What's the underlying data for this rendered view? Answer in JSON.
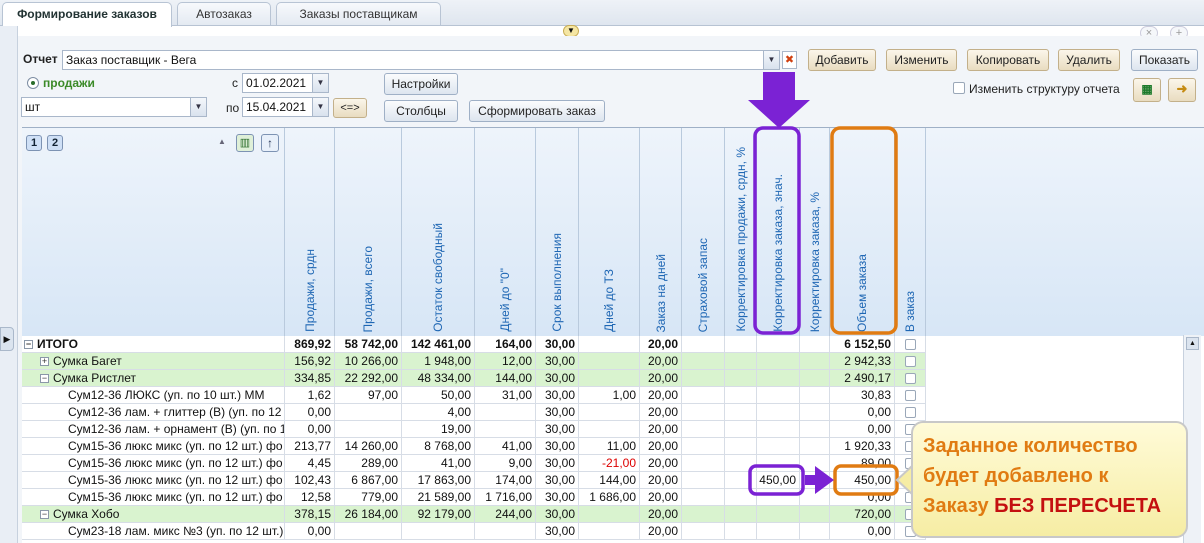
{
  "tabs": [
    "Формирование заказов",
    "Автозаказ",
    "Заказы поставщикам"
  ],
  "toolbar": {
    "report_label": "Отчет",
    "report_value": "Заказ поставщик - Вега",
    "buttons": [
      "Добавить",
      "Изменить",
      "Копировать",
      "Удалить",
      "Показать"
    ],
    "radio_label": "продажи",
    "unit_value": "шт",
    "from_label": "с",
    "from_date": "01.02.2021",
    "to_label": "по",
    "to_date": "15.04.2021",
    "swap_label": "<=>",
    "settings_label": "Настройки",
    "columns_label": "Столбцы",
    "make_order_label": "Сформировать заказ",
    "change_structure_label": "Изменить структуру отчета",
    "level1": "1",
    "level2": "2"
  },
  "columns": [
    "Продажи, срдн",
    "Продажи, всего",
    "Остаток свободный",
    "Дней до \"0\"",
    "Срок выполнения",
    "Дней до ТЗ",
    "Заказ на дней",
    "Страховой запас",
    "Корректировка продажи, срдн, %",
    "Корректировка заказа, знач.",
    "Корректировка заказа, %",
    "Объем заказа",
    "В заказ"
  ],
  "rows": [
    {
      "name": "ИТОГО",
      "level": 0,
      "exp": "−",
      "bold": true,
      "green": false,
      "v": [
        "869,92",
        "58 742,00",
        "142 461,00",
        "164,00",
        "30,00",
        "",
        "20,00",
        "",
        "",
        "",
        "",
        "6 152,50"
      ]
    },
    {
      "name": "Сумка Багет",
      "level": 1,
      "exp": "+",
      "bold": false,
      "green": true,
      "v": [
        "156,92",
        "10 266,00",
        "1 948,00",
        "12,00",
        "30,00",
        "",
        "20,00",
        "",
        "",
        "",
        "",
        "2 942,33"
      ]
    },
    {
      "name": "Сумка Ристлет",
      "level": 1,
      "exp": "−",
      "bold": false,
      "green": true,
      "v": [
        "334,85",
        "22 292,00",
        "48 334,00",
        "144,00",
        "30,00",
        "",
        "20,00",
        "",
        "",
        "",
        "",
        "2 490,17"
      ]
    },
    {
      "name": "Сум12-36 ЛЮКС (уп. по 10 шт.) ММ",
      "level": 2,
      "exp": "",
      "bold": false,
      "green": false,
      "v": [
        "1,62",
        "97,00",
        "50,00",
        "31,00",
        "30,00",
        "1,00",
        "20,00",
        "",
        "",
        "",
        "",
        "30,83"
      ]
    },
    {
      "name": "Сум12-36 лам. + глиттер (В) (уп. по 12",
      "level": 2,
      "exp": "",
      "bold": false,
      "green": false,
      "v": [
        "0,00",
        "",
        "4,00",
        "",
        "30,00",
        "",
        "20,00",
        "",
        "",
        "",
        "",
        "0,00"
      ]
    },
    {
      "name": "Сум12-36 лам. + орнамент (В) (уп. по 1",
      "level": 2,
      "exp": "",
      "bold": false,
      "green": false,
      "v": [
        "0,00",
        "",
        "19,00",
        "",
        "30,00",
        "",
        "20,00",
        "",
        "",
        "",
        "",
        "0,00"
      ]
    },
    {
      "name": "Сум15-36 люкс микс (уп. по 12 шт.) фо",
      "level": 2,
      "exp": "",
      "bold": false,
      "green": false,
      "v": [
        "213,77",
        "14 260,00",
        "8 768,00",
        "41,00",
        "30,00",
        "11,00",
        "20,00",
        "",
        "",
        "",
        "",
        "1 920,33"
      ]
    },
    {
      "name": "Сум15-36 люкс микс (уп. по 12 шт.) фо",
      "level": 2,
      "exp": "",
      "bold": false,
      "green": false,
      "v": [
        "4,45",
        "289,00",
        "41,00",
        "9,00",
        "30,00",
        "-21,00",
        "20,00",
        "",
        "",
        "",
        "",
        "89,00"
      ]
    },
    {
      "name": "Сум15-36 люкс микс (уп. по 12 шт.) фо",
      "level": 2,
      "exp": "",
      "bold": false,
      "green": false,
      "v": [
        "102,43",
        "6 867,00",
        "17 863,00",
        "174,00",
        "30,00",
        "144,00",
        "20,00",
        "",
        "",
        "450,00",
        "",
        "450,00"
      ]
    },
    {
      "name": "Сум15-36 люкс микс (уп. по 12 шт.) фо",
      "level": 2,
      "exp": "",
      "bold": false,
      "green": false,
      "v": [
        "12,58",
        "779,00",
        "21 589,00",
        "1 716,00",
        "30,00",
        "1 686,00",
        "20,00",
        "",
        "",
        "",
        "",
        "0,00"
      ]
    },
    {
      "name": "Сумка Хобо",
      "level": 1,
      "exp": "−",
      "bold": false,
      "green": true,
      "v": [
        "378,15",
        "26 184,00",
        "92 179,00",
        "244,00",
        "30,00",
        "",
        "20,00",
        "",
        "",
        "",
        "",
        "720,00"
      ]
    },
    {
      "name": "Сум23-18 лам. микс №3 (уп. по 12 шт.)",
      "level": 2,
      "exp": "",
      "bold": false,
      "green": false,
      "v": [
        "0,00",
        "",
        "",
        "",
        "30,00",
        "",
        "20,00",
        "",
        "",
        "",
        "",
        "0,00"
      ]
    }
  ],
  "callout": {
    "text": "Заданное количество будет добавлено к Заказу",
    "emphasis": "БЕЗ ПЕРЕСЧЕТА"
  },
  "colors": {
    "purple": "#7b22d4",
    "orange": "#e07b12",
    "green_row": "#d9f3cf",
    "header_text": "#1f67b4",
    "negative": "#d00000"
  }
}
